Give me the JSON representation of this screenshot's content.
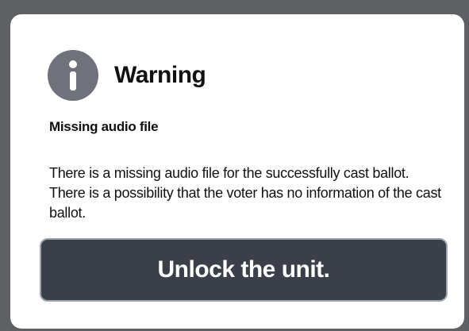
{
  "dialog": {
    "icon": "info-icon",
    "title": "Warning",
    "subtitle": "Missing audio file",
    "message": "There is a missing audio file for the successfully cast ballot. There is a possibility that the voter has no information of the cast ballot.",
    "action_label": "Unlock the unit."
  },
  "colors": {
    "backdrop": "#5f6063",
    "dialog_background": "#ffffff",
    "icon_background": "#6f727a",
    "button_background": "#3b3f4a",
    "button_border": "#9ea3ad",
    "text": "#111111"
  }
}
